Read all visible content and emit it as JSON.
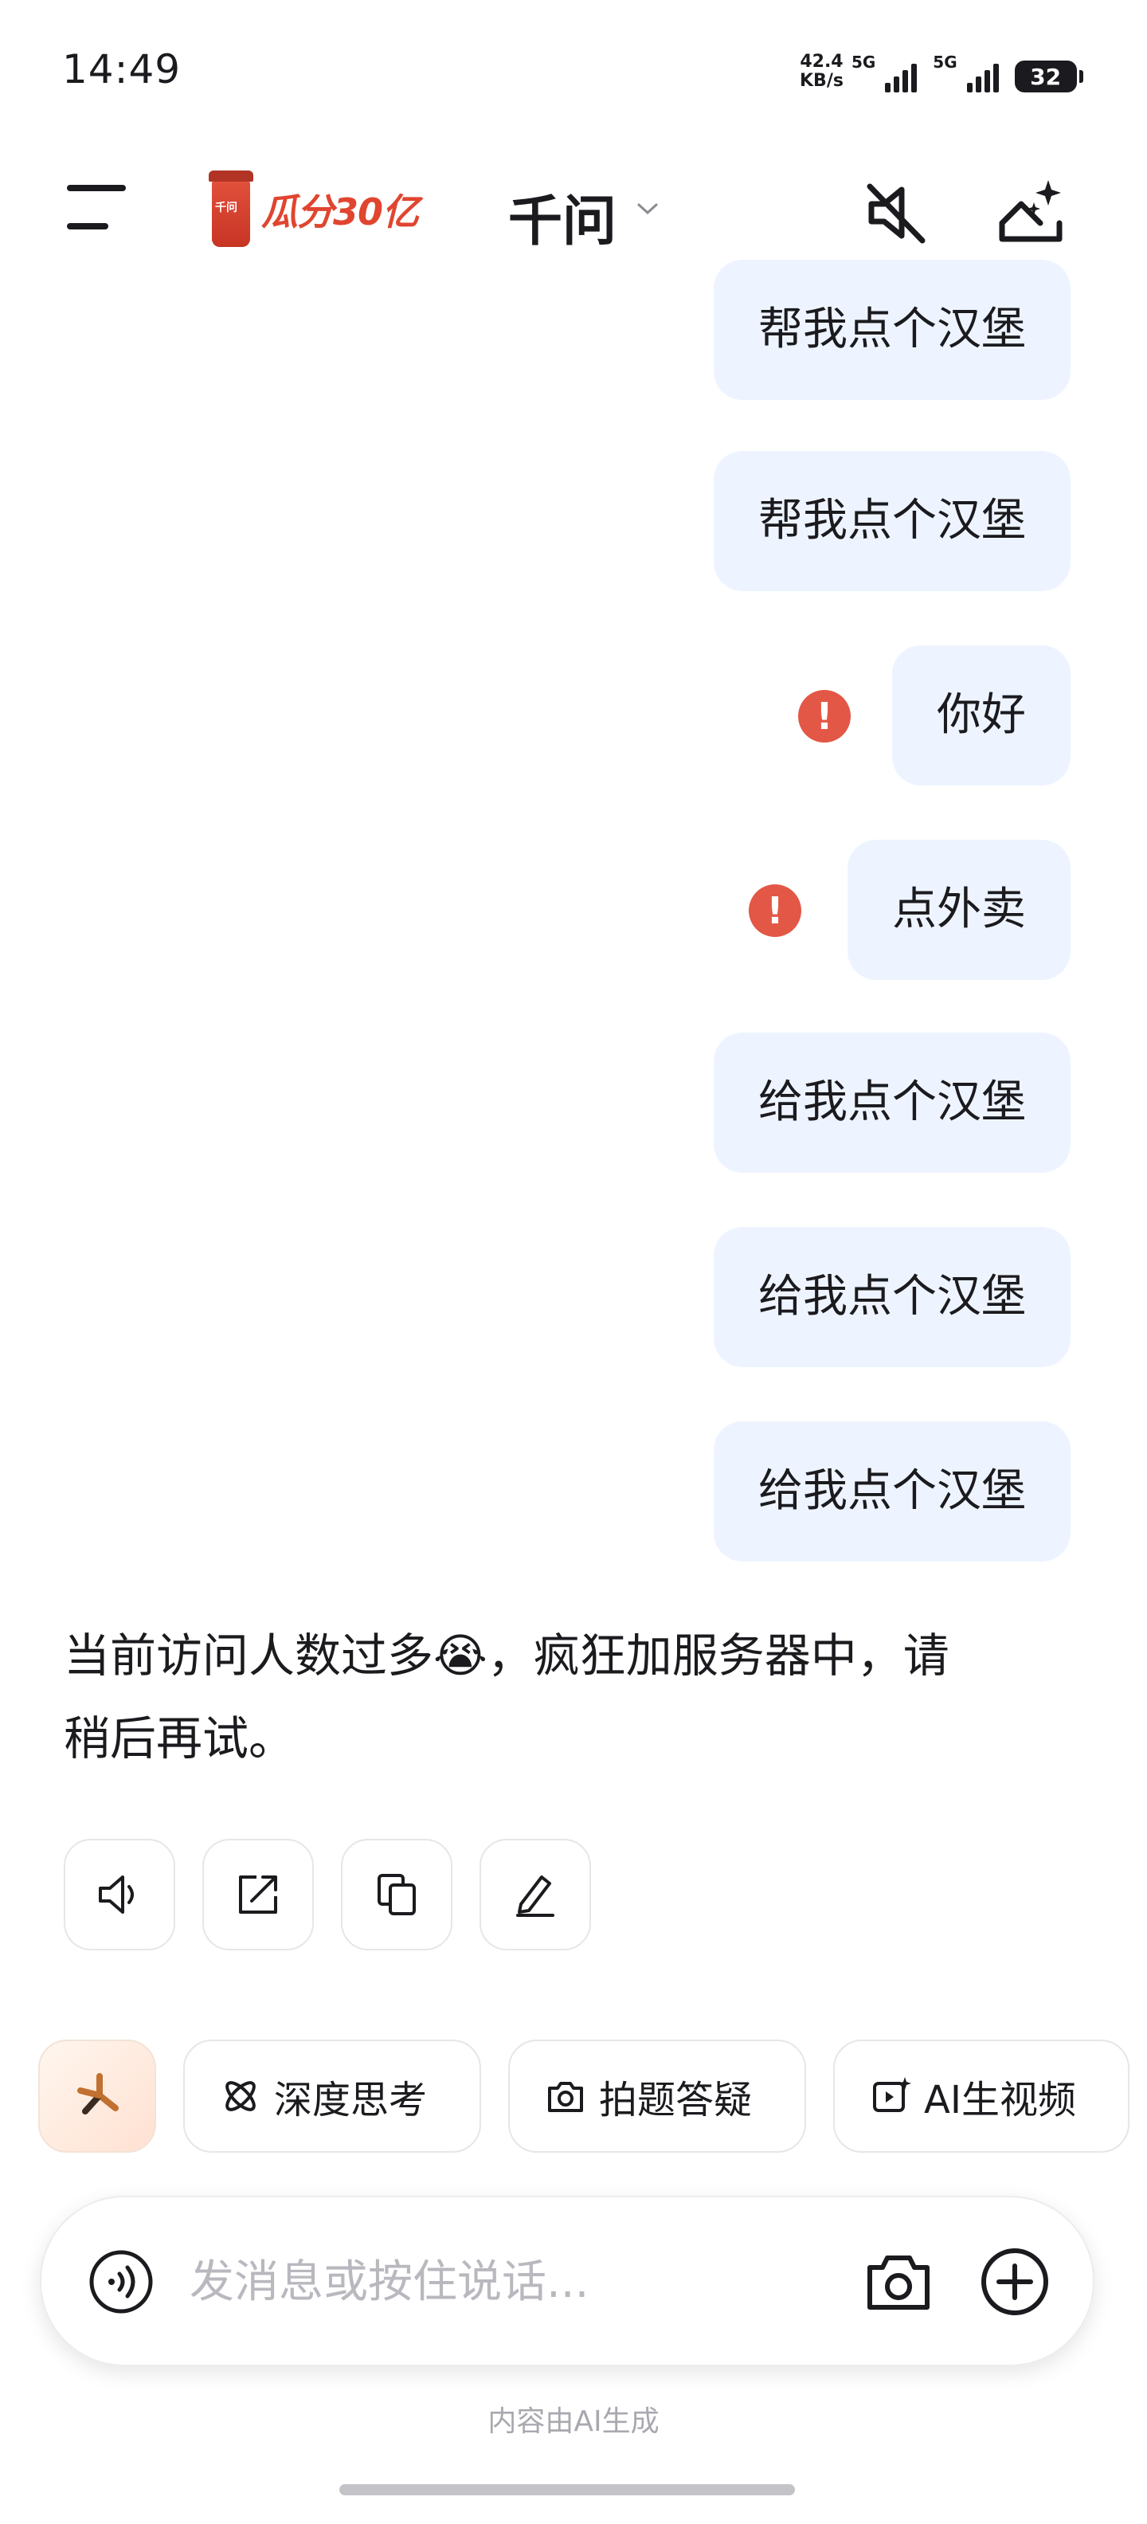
{
  "status_bar": {
    "time": "14:49",
    "net_speed_value": "42.4",
    "net_speed_unit": "KB/s",
    "sim1": "5G",
    "sim2": "5G",
    "battery": "32"
  },
  "header": {
    "promo_text": "瓜分30亿",
    "cup_logo_text": "千问",
    "title": "千问",
    "icons": [
      "menu-icon",
      "chevron-down-icon",
      "speaker-muted-icon",
      "new-chat-sparkle-icon"
    ]
  },
  "messages": [
    {
      "role": "user",
      "text": "帮我点个汉堡",
      "error": false
    },
    {
      "role": "user",
      "text": "帮我点个汉堡",
      "error": false
    },
    {
      "role": "user",
      "text": "你好",
      "error": true
    },
    {
      "role": "user",
      "text": "点外卖",
      "error": true
    },
    {
      "role": "user",
      "text": "给我点个汉堡",
      "error": false
    },
    {
      "role": "user",
      "text": "给我点个汉堡",
      "error": false
    },
    {
      "role": "user",
      "text": "给我点个汉堡",
      "error": false
    }
  ],
  "error_mark": "!",
  "assistant_reply": {
    "line1": "当前访问人数过多😭，疯狂加服务器中，请",
    "line2": "稍后再试。"
  },
  "reply_actions": [
    "speaker-icon",
    "share-icon",
    "copy-icon",
    "edit-icon"
  ],
  "chips": {
    "deep_think": "深度思考",
    "photo_answer": "拍题答疑",
    "ai_video": "AI生视频"
  },
  "input": {
    "placeholder": "发消息或按住说话..."
  },
  "footer_note": "内容由AI生成",
  "colors": {
    "bubble_bg": "#eef4ff",
    "error_red": "#e35746",
    "promo_red": "#e0452f"
  }
}
